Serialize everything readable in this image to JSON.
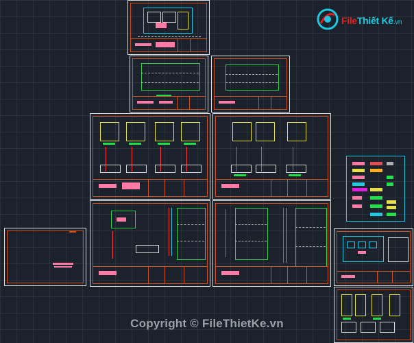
{
  "logo": {
    "part1": "File",
    "part2": "Thiết Kế",
    "tld": ".vn"
  },
  "watermark": {
    "copyright": "Copyright © FileThietKe.vn"
  },
  "colors": {
    "background": "#1c222b",
    "grid": "#2a313b",
    "frame": "#d05020",
    "text_pink": "#ff7ba6",
    "line_yellow": "#e8e04a",
    "line_green": "#22e04a",
    "line_cyan": "#22c8e0",
    "line_red": "#ff4040",
    "logo_red": "#e02020",
    "logo_cyan": "#22c8e0"
  },
  "sheets": [
    {
      "id": "site-plan-sheet",
      "icon": "site-plan-drawing"
    },
    {
      "id": "foundation-plan-sheet-1",
      "icon": "foundation-plan-drawing"
    },
    {
      "id": "foundation-plan-sheet-2",
      "icon": "foundation-plan-drawing"
    },
    {
      "id": "footing-detail-sheet-1",
      "icon": "footing-detail-drawing"
    },
    {
      "id": "footing-detail-sheet-2",
      "icon": "footing-detail-drawing"
    },
    {
      "id": "column-detail-sheet-1",
      "icon": "column-detail-drawing"
    },
    {
      "id": "column-detail-sheet-2",
      "icon": "column-detail-drawing"
    },
    {
      "id": "cover-sheet",
      "icon": "cover-drawing"
    },
    {
      "id": "elevation-sheet",
      "icon": "elevation-drawing"
    },
    {
      "id": "stair-detail-sheet",
      "icon": "stair-detail-drawing"
    }
  ],
  "legend": {
    "icon": "layer-legend"
  }
}
